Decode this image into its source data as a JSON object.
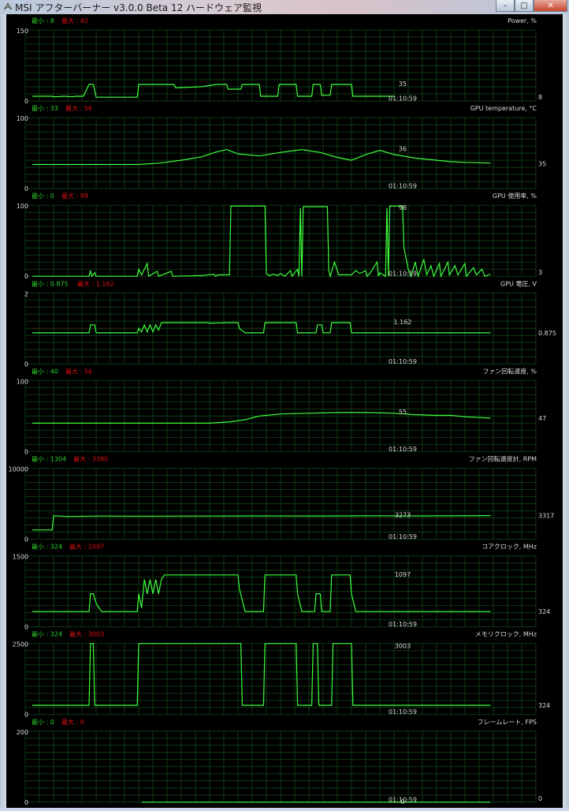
{
  "window": {
    "title": "MSI アフターバーナー v3.0.0 Beta 12 ハードウェア監視",
    "buttons": {
      "minimize": "–",
      "maximize": "□",
      "close": "✕"
    }
  },
  "colors": {
    "background": "#000000",
    "grid": "#0f3a14",
    "line": "#3dff3d",
    "min_text": "#2fd22f",
    "max_text": "#e01010",
    "label": "#d9d9d9"
  },
  "graphs": [
    {
      "title": "Power, %",
      "min_label": "最小 : 8",
      "max_label": "最大 : 42",
      "y_max": "150",
      "y_min": "0",
      "ymax": 150,
      "current": "8",
      "current_value": 8,
      "cursor_value": "35",
      "cursor_time": "01:10:59",
      "series": [
        [
          0.5,
          10
        ],
        [
          1.9,
          10
        ],
        [
          2.0,
          9
        ],
        [
          2.2,
          9
        ],
        [
          2.7,
          10
        ],
        [
          3.3,
          9
        ],
        [
          3.6,
          10
        ],
        [
          4.0,
          10
        ],
        [
          4.1,
          10
        ],
        [
          4.5,
          35
        ],
        [
          4.8,
          35
        ],
        [
          5.0,
          8
        ],
        [
          7.9,
          8
        ],
        [
          8.0,
          35
        ],
        [
          10.5,
          35
        ],
        [
          10.6,
          28
        ],
        [
          12.4,
          30
        ],
        [
          13.5,
          35
        ],
        [
          14.2,
          35
        ],
        [
          14.3,
          25
        ],
        [
          15.2,
          25
        ],
        [
          15.3,
          35
        ],
        [
          16.5,
          35
        ],
        [
          16.6,
          10
        ],
        [
          17.8,
          10
        ],
        [
          17.9,
          35
        ],
        [
          19.1,
          35
        ],
        [
          19.2,
          10
        ],
        [
          20.2,
          10
        ],
        [
          20.3,
          35
        ],
        [
          20.8,
          35
        ],
        [
          20.9,
          12
        ],
        [
          21.5,
          12
        ],
        [
          21.6,
          35
        ],
        [
          23.0,
          35
        ],
        [
          23.1,
          10
        ],
        [
          26.0,
          10
        ]
      ]
    },
    {
      "title": "GPU temperature, °C",
      "min_label": "最小 : 33",
      "max_label": "最大 : 56",
      "y_max": "100",
      "y_min": "0",
      "ymax": 100,
      "current": "35",
      "current_value": 35,
      "cursor_value": "36",
      "cursor_time": "01:10:59",
      "series": [
        [
          0.5,
          34
        ],
        [
          5.0,
          34
        ],
        [
          8.0,
          34
        ],
        [
          9.5,
          36
        ],
        [
          11.0,
          40
        ],
        [
          12.5,
          45
        ],
        [
          13.5,
          52
        ],
        [
          14.2,
          55
        ],
        [
          15.0,
          49
        ],
        [
          16.5,
          46
        ],
        [
          18.0,
          51
        ],
        [
          19.5,
          55
        ],
        [
          20.8,
          51
        ],
        [
          22.0,
          44
        ],
        [
          23.0,
          40
        ],
        [
          24.0,
          48
        ],
        [
          25.0,
          54
        ],
        [
          26.0,
          48
        ],
        [
          27.5,
          43
        ],
        [
          29.0,
          40
        ],
        [
          30.0,
          38
        ],
        [
          31.0,
          37
        ],
        [
          32.8,
          36
        ]
      ]
    },
    {
      "title": "GPU 使用率, %",
      "min_label": "最小 : 0",
      "max_label": "最大 : 99",
      "y_max": "100",
      "y_min": "0",
      "ymax": 100,
      "current": "3",
      "current_value": 3,
      "cursor_value": "98",
      "cursor_time": "01:10:59",
      "series": [
        [
          0.5,
          0
        ],
        [
          4.5,
          0
        ],
        [
          4.6,
          8
        ],
        [
          4.7,
          0
        ],
        [
          4.9,
          5
        ],
        [
          5.0,
          0
        ],
        [
          7.9,
          0
        ],
        [
          8.0,
          10
        ],
        [
          8.2,
          2
        ],
        [
          8.6,
          18
        ],
        [
          8.7,
          0
        ],
        [
          9.3,
          7
        ],
        [
          9.4,
          0
        ],
        [
          10.3,
          7
        ],
        [
          10.4,
          0
        ],
        [
          12.5,
          1
        ],
        [
          13.3,
          3
        ],
        [
          13.4,
          0
        ],
        [
          13.6,
          2
        ],
        [
          14.4,
          2
        ],
        [
          14.5,
          99
        ],
        [
          16.9,
          99
        ],
        [
          17.0,
          4
        ],
        [
          17.2,
          1
        ],
        [
          17.5,
          3
        ],
        [
          17.8,
          1
        ],
        [
          18.0,
          4
        ],
        [
          18.3,
          0
        ],
        [
          18.7,
          8
        ],
        [
          18.8,
          0
        ],
        [
          19.2,
          10
        ],
        [
          19.3,
          0
        ],
        [
          19.4,
          96
        ],
        [
          19.5,
          0
        ],
        [
          19.6,
          98
        ],
        [
          21.3,
          98
        ],
        [
          21.4,
          8
        ],
        [
          21.5,
          0
        ],
        [
          21.8,
          20
        ],
        [
          22.1,
          2
        ],
        [
          23.0,
          2
        ],
        [
          23.3,
          8
        ],
        [
          23.6,
          4
        ],
        [
          24.0,
          8
        ],
        [
          24.1,
          0
        ],
        [
          24.3,
          4
        ],
        [
          24.8,
          20
        ],
        [
          24.9,
          0
        ],
        [
          25.0,
          5
        ],
        [
          25.4,
          0
        ],
        [
          25.5,
          96
        ],
        [
          25.6,
          0
        ],
        [
          25.7,
          99
        ],
        [
          26.6,
          99
        ],
        [
          26.7,
          40
        ],
        [
          27.0,
          10
        ],
        [
          27.2,
          0
        ],
        [
          27.5,
          20
        ],
        [
          27.7,
          0
        ],
        [
          28.1,
          24
        ],
        [
          28.3,
          2
        ],
        [
          28.6,
          15
        ],
        [
          28.8,
          0
        ],
        [
          29.2,
          18
        ],
        [
          29.3,
          0
        ],
        [
          29.8,
          20
        ],
        [
          29.9,
          2
        ],
        [
          30.3,
          15
        ],
        [
          30.5,
          2
        ],
        [
          31.0,
          18
        ],
        [
          31.1,
          0
        ],
        [
          31.6,
          12
        ],
        [
          31.8,
          2
        ],
        [
          32.2,
          10
        ],
        [
          32.4,
          0
        ],
        [
          32.8,
          3
        ]
      ]
    },
    {
      "title": "GPU 電圧, V",
      "min_label": "最小 : 0.875",
      "max_label": "最大 : 1.162",
      "y_max": "2",
      "y_min": "0",
      "ymax": 2,
      "current": "0.875",
      "current_value": 0.875,
      "cursor_value": "1.162",
      "cursor_time": "01:10:59",
      "series": [
        [
          0.5,
          0.875
        ],
        [
          4.5,
          0.875
        ],
        [
          4.6,
          1.1
        ],
        [
          4.9,
          1.1
        ],
        [
          5.0,
          0.875
        ],
        [
          7.9,
          0.875
        ],
        [
          8.0,
          1.0
        ],
        [
          8.2,
          0.9
        ],
        [
          8.4,
          1.1
        ],
        [
          8.6,
          0.9
        ],
        [
          8.8,
          1.1
        ],
        [
          9.0,
          0.9
        ],
        [
          9.2,
          1.1
        ],
        [
          9.4,
          0.95
        ],
        [
          9.6,
          1.162
        ],
        [
          12.9,
          1.162
        ],
        [
          13.0,
          1.15
        ],
        [
          14.4,
          1.162
        ],
        [
          15.0,
          1.162
        ],
        [
          15.1,
          1.0
        ],
        [
          15.5,
          0.875
        ],
        [
          16.8,
          0.875
        ],
        [
          16.9,
          1.162
        ],
        [
          19.1,
          1.162
        ],
        [
          19.2,
          0.875
        ],
        [
          20.5,
          0.875
        ],
        [
          20.6,
          1.1
        ],
        [
          20.9,
          1.1
        ],
        [
          21.0,
          0.875
        ],
        [
          21.5,
          0.875
        ],
        [
          21.6,
          1.162
        ],
        [
          22.9,
          1.162
        ],
        [
          23.0,
          0.875
        ],
        [
          32.8,
          0.875
        ]
      ]
    },
    {
      "title": "ファン回転速度, %",
      "min_label": "最小 : 40",
      "max_label": "最大 : 56",
      "y_max": "100",
      "y_min": "0",
      "ymax": 100,
      "current": "47",
      "current_value": 47,
      "cursor_value": "55",
      "cursor_time": "01:10:59",
      "series": [
        [
          0.5,
          40
        ],
        [
          13.0,
          40
        ],
        [
          14.5,
          42
        ],
        [
          15.5,
          45
        ],
        [
          16.5,
          50
        ],
        [
          18.0,
          53
        ],
        [
          20.0,
          54
        ],
        [
          22.0,
          55
        ],
        [
          24.0,
          55
        ],
        [
          26.0,
          54
        ],
        [
          27.5,
          52
        ],
        [
          29.0,
          51
        ],
        [
          30.0,
          51
        ],
        [
          31.0,
          49
        ],
        [
          32.0,
          48
        ],
        [
          32.8,
          47
        ]
      ]
    },
    {
      "title": "ファン回転速度計, RPM",
      "min_label": "最小 : 1304",
      "max_label": "最大 : 3380",
      "y_max": "10000",
      "y_min": "0",
      "ymax": 10000,
      "current": "3317",
      "current_value": 3317,
      "cursor_value": "3273",
      "cursor_time": "01:10:59",
      "series": [
        [
          0.5,
          1304
        ],
        [
          1.9,
          1304
        ],
        [
          2.0,
          3300
        ],
        [
          3.0,
          3200
        ],
        [
          5.0,
          3260
        ],
        [
          8.0,
          3250
        ],
        [
          12.0,
          3260
        ],
        [
          16.0,
          3280
        ],
        [
          20.0,
          3270
        ],
        [
          24.0,
          3290
        ],
        [
          28.0,
          3280
        ],
        [
          32.8,
          3317
        ]
      ]
    },
    {
      "title": "コアクロック, MHz",
      "min_label": "最小 : 324",
      "max_label": "最大 : 1097",
      "y_max": "1500",
      "y_min": "0",
      "ymax": 1500,
      "current": "324",
      "current_value": 324,
      "cursor_value": "1097",
      "cursor_time": "01:10:59",
      "series": [
        [
          0.5,
          324
        ],
        [
          4.5,
          324
        ],
        [
          4.6,
          700
        ],
        [
          4.8,
          700
        ],
        [
          5.0,
          500
        ],
        [
          5.2,
          400
        ],
        [
          5.4,
          324
        ],
        [
          7.9,
          324
        ],
        [
          8.0,
          700
        ],
        [
          8.2,
          400
        ],
        [
          8.4,
          1000
        ],
        [
          8.6,
          700
        ],
        [
          8.8,
          1000
        ],
        [
          9.0,
          700
        ],
        [
          9.2,
          1000
        ],
        [
          9.4,
          700
        ],
        [
          9.6,
          1000
        ],
        [
          9.8,
          1097
        ],
        [
          12.9,
          1097
        ],
        [
          13.0,
          1097
        ],
        [
          14.4,
          1097
        ],
        [
          15.0,
          1097
        ],
        [
          15.1,
          800
        ],
        [
          15.5,
          324
        ],
        [
          16.8,
          324
        ],
        [
          16.9,
          1097
        ],
        [
          19.1,
          1097
        ],
        [
          19.2,
          700
        ],
        [
          19.5,
          324
        ],
        [
          20.4,
          324
        ],
        [
          20.5,
          700
        ],
        [
          20.8,
          700
        ],
        [
          20.9,
          324
        ],
        [
          21.5,
          324
        ],
        [
          21.6,
          1097
        ],
        [
          22.9,
          1097
        ],
        [
          23.0,
          700
        ],
        [
          23.3,
          324
        ],
        [
          32.8,
          324
        ]
      ]
    },
    {
      "title": "メモリクロック, MHz",
      "min_label": "最小 : 324",
      "max_label": "最大 : 3003",
      "y_max": "2500",
      "y_min": "0",
      "ymax": 2500,
      "current": "324",
      "current_value": 324,
      "cursor_value": "3003",
      "cursor_time": "01:10:59",
      "series": [
        [
          0.5,
          324
        ],
        [
          4.5,
          324
        ],
        [
          4.6,
          3003
        ],
        [
          4.8,
          3003
        ],
        [
          4.9,
          324
        ],
        [
          7.9,
          324
        ],
        [
          8.0,
          3003
        ],
        [
          15.2,
          3003
        ],
        [
          15.3,
          324
        ],
        [
          16.8,
          324
        ],
        [
          16.9,
          3003
        ],
        [
          19.1,
          3003
        ],
        [
          19.2,
          324
        ],
        [
          20.2,
          324
        ],
        [
          20.3,
          3003
        ],
        [
          20.6,
          3003
        ],
        [
          20.7,
          324
        ],
        [
          21.6,
          324
        ],
        [
          21.7,
          3003
        ],
        [
          23.0,
          3003
        ],
        [
          23.1,
          324
        ],
        [
          32.8,
          324
        ]
      ]
    },
    {
      "title": "フレームレート, FPS",
      "min_label": "最小 : 0",
      "max_label": "最大 : 0",
      "y_max": "200",
      "y_min": "0",
      "ymax": 200,
      "current": "0",
      "current_value": 0,
      "cursor_value": "0",
      "cursor_time": "01:10:59",
      "series": [
        [
          8.2,
          0
        ],
        [
          32.8,
          0
        ]
      ]
    }
  ]
}
